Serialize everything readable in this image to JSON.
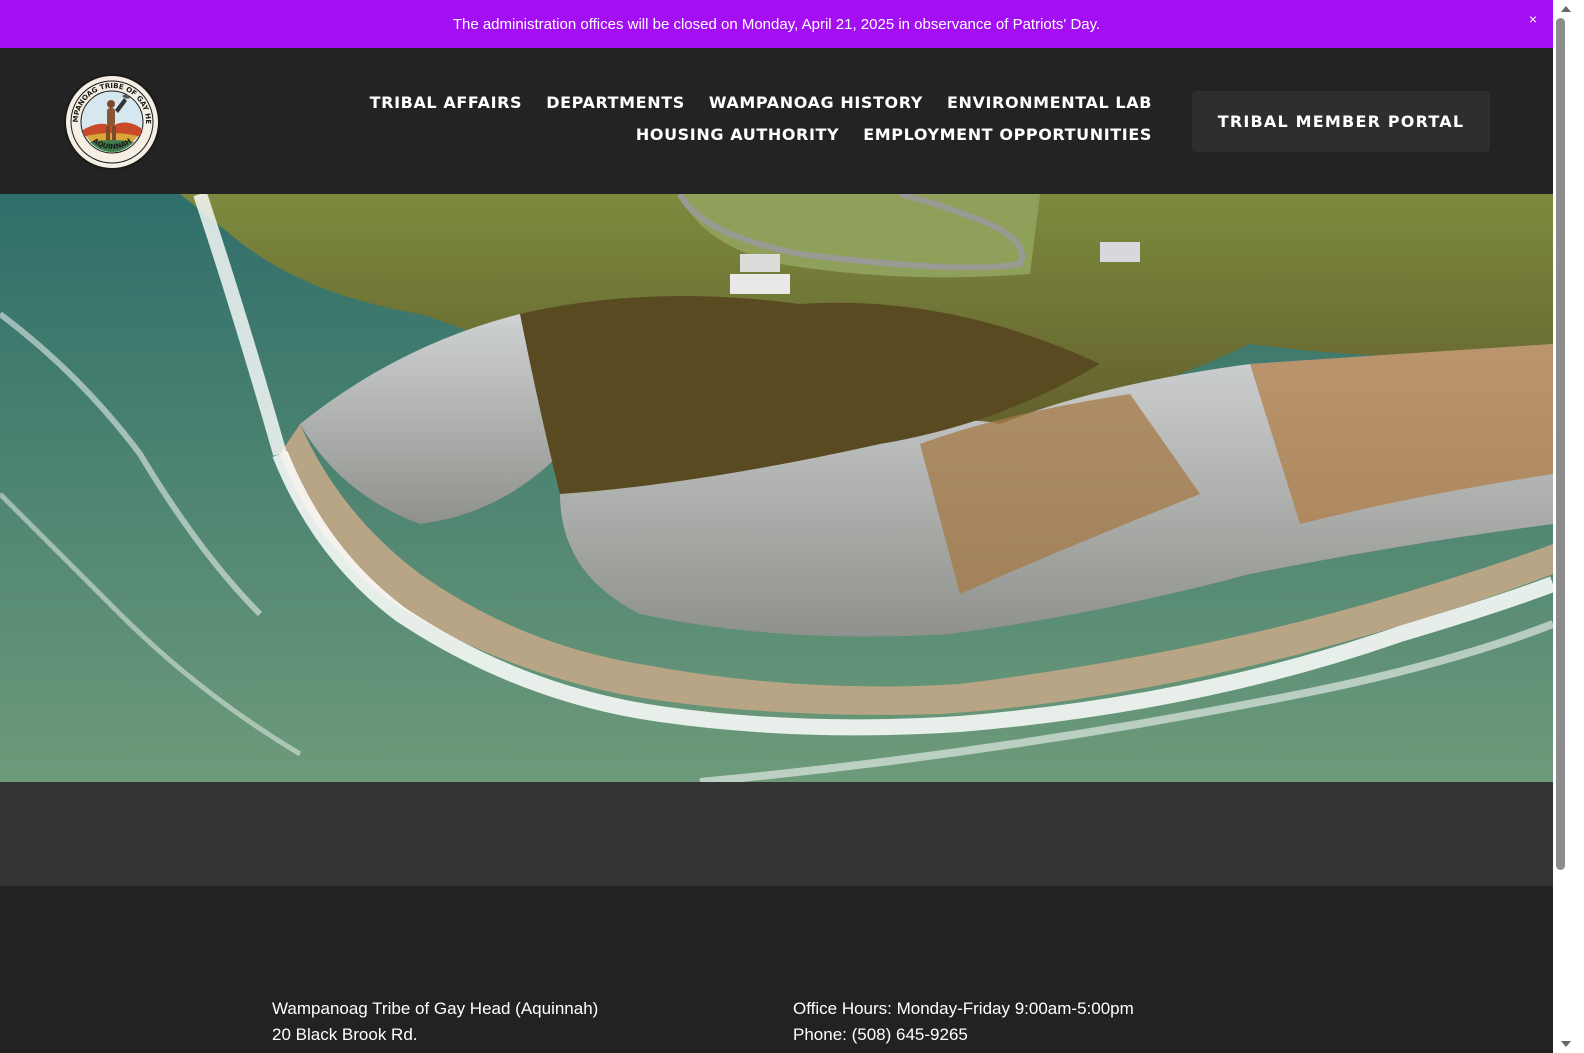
{
  "announcement": {
    "text": "The administration offices will be closed on Monday, April 21, 2025 in observance of Patriots' Day.",
    "close_label": "×",
    "background": "#a30ff2"
  },
  "header": {
    "logo_top_text": "WAMPANOAG TRIBE OF GAY HEAD",
    "logo_bottom_text": "AQUINNAH",
    "nav": [
      {
        "label": "TRIBAL AFFAIRS"
      },
      {
        "label": "DEPARTMENTS"
      },
      {
        "label": "WAMPANOAG HISTORY"
      },
      {
        "label": "ENVIRONMENTAL LAB"
      },
      {
        "label": "HOUSING AUTHORITY"
      },
      {
        "label": "EMPLOYMENT OPPORTUNITIES"
      }
    ],
    "portal_button": "TRIBAL MEMBER PORTAL"
  },
  "hero": {
    "image": "aerial-cliffs-coastline"
  },
  "footer": {
    "left": [
      "Wampanoag Tribe of Gay Head (Aquinnah)",
      "20 Black Brook Rd."
    ],
    "right": [
      "Office Hours: Monday-Friday 9:00am-5:00pm",
      "Phone: (508) 645-9265"
    ]
  }
}
